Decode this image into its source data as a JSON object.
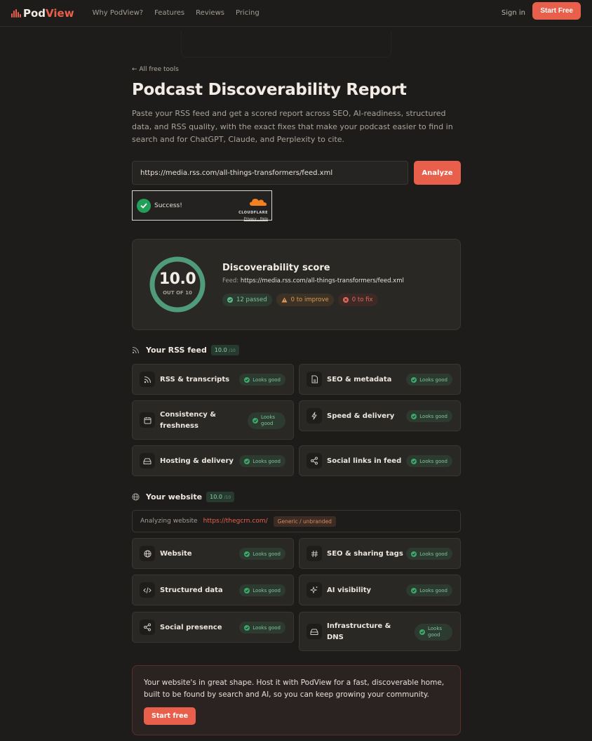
{
  "header": {
    "logo_pod": "Pod",
    "logo_view": "View",
    "nav": [
      "Why PodView?",
      "Features",
      "Reviews",
      "Pricing"
    ],
    "sign_in": "Sign in",
    "start_free": "Start Free"
  },
  "back_link": "← All free tools",
  "title": "Podcast Discoverability Report",
  "description": "Paste your RSS feed and get a scored report across SEO, AI-readiness, structured data, and RSS quality, with the exact fixes that make your podcast easier to find in search and for ChatGPT, Claude, and Perplexity to cite.",
  "feed_input": {
    "value": "https://media.rss.com/all-things-transformers/feed.xml"
  },
  "analyze_label": "Analyze",
  "captcha": {
    "status": "Success!",
    "brand": "CLOUDFLARE",
    "privacy": "Privacy",
    "help": "Help"
  },
  "score": {
    "value": "10.0",
    "out_of": "OUT OF 10",
    "fraction": 1.0,
    "label": "Discoverability score",
    "feed_prefix": "Feed:",
    "feed_url": "https://media.rss.com/all-things-transformers/feed.xml",
    "passed": "12 passed",
    "to_improve": "0 to improve",
    "to_fix": "0 to fix"
  },
  "rss_section": {
    "title": "Your RSS feed",
    "score": "10.0",
    "score_max": "/10",
    "items": [
      {
        "label": "RSS & transcripts",
        "status": "Looks good"
      },
      {
        "label": "SEO & metadata",
        "status": "Looks good"
      },
      {
        "label": "Consistency & freshness",
        "status": "Looks good"
      },
      {
        "label": "Speed & delivery",
        "status": "Looks good"
      },
      {
        "label": "Hosting & delivery",
        "status": "Looks good"
      },
      {
        "label": "Social links in feed",
        "status": "Looks good"
      }
    ]
  },
  "website_section": {
    "title": "Your website",
    "score": "10.0",
    "score_max": "/10",
    "analyzing_label": "Analyzing website",
    "site_url": "https://thegcrn.com/",
    "site_tag": "Generic / unbranded",
    "items": [
      {
        "label": "Website",
        "status": "Looks good"
      },
      {
        "label": "SEO & sharing tags",
        "status": "Looks good"
      },
      {
        "label": "Structured data",
        "status": "Looks good"
      },
      {
        "label": "AI visibility",
        "status": "Looks good"
      },
      {
        "label": "Social presence",
        "status": "Looks good"
      },
      {
        "label": "Infrastructure & DNS",
        "status": "Looks good"
      }
    ]
  },
  "cta": {
    "text": "Your website's in great shape. Host it with PodView for a fast, discoverable home, built to be found by search and AI, so you can keep growing your community.",
    "button": "Start free"
  },
  "colors": {
    "accent": "#e8604c",
    "good": "#4f9b7a",
    "background": "#1e1c1a"
  }
}
